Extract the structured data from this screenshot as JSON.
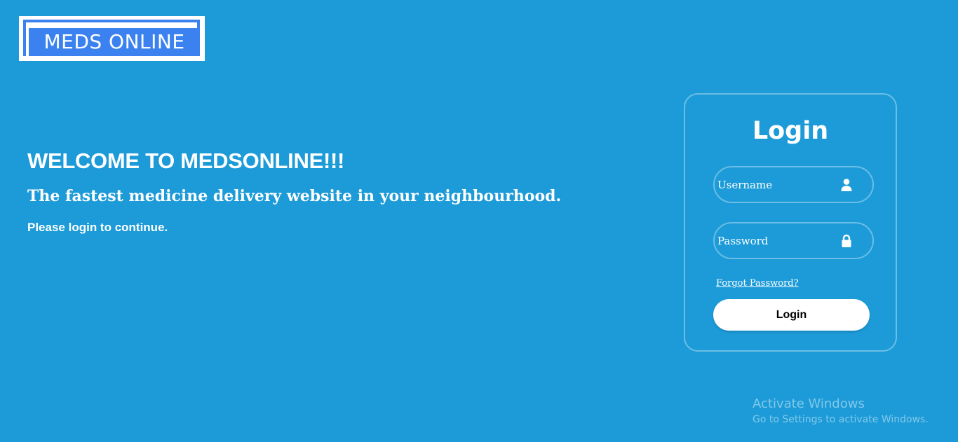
{
  "logo": {
    "text": "MEDS ONLINE"
  },
  "welcome": {
    "title": "WELCOME TO MEDSONLINE!!!",
    "subtitle": "The fastest medicine delivery website in your neighbourhood.",
    "note": "Please login to continue."
  },
  "login": {
    "heading": "Login",
    "username": {
      "placeholder": "Username",
      "value": "",
      "icon": "user-icon"
    },
    "password": {
      "placeholder": "Password",
      "value": "",
      "icon": "lock-icon"
    },
    "forgot_label": "Forgot Password?",
    "button_label": "Login"
  },
  "watermark": {
    "title": "Activate Windows",
    "subtitle": "Go to Settings to activate Windows."
  },
  "colors": {
    "background": "#1c9bd8",
    "logo_blue": "#3b82f0",
    "button_bg": "#ffffff",
    "text": "#ffffff"
  }
}
